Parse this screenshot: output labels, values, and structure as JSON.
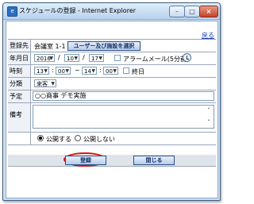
{
  "window": {
    "title": "スケジュールの登録 - Internet Explorer",
    "min": "–",
    "max": "□",
    "close": "×"
  },
  "back_link": "戻る",
  "form": {
    "registrant": {
      "label": "登録先",
      "value": "会議室 1-1",
      "select_button": "ユーザー及び施設を選択"
    },
    "date": {
      "label": "年月日",
      "year": "2016",
      "month": "10",
      "day": "17",
      "sep_year": "/",
      "sep_month": "/",
      "alarm_label": "アラームメール(5分前)"
    },
    "time": {
      "label": "時刻",
      "start_hour": "13",
      "start_min": "00",
      "end_hour": "14",
      "end_min": "00",
      "sep_hm1": ":",
      "sep_range": "~",
      "sep_hm2": ":",
      "allday_label": "終日"
    },
    "category": {
      "label": "分類",
      "value": "来客"
    },
    "subject": {
      "label": "予定",
      "value": "○○商事 デモ実施"
    },
    "notes": {
      "label": "備考",
      "value": ""
    },
    "publish": {
      "public_label": "公開する",
      "private_label": "公開しない",
      "selected": "public"
    }
  },
  "footer": {
    "register": "登録",
    "close": "閉じる"
  },
  "colors": {
    "title_bg": "#b8d2ee",
    "label_bg": "#eef1f7",
    "highlight": "#d01818",
    "link": "#1a3fb8"
  },
  "icons": {
    "title": "ie-page-icon",
    "alarm": "clock-icon"
  }
}
